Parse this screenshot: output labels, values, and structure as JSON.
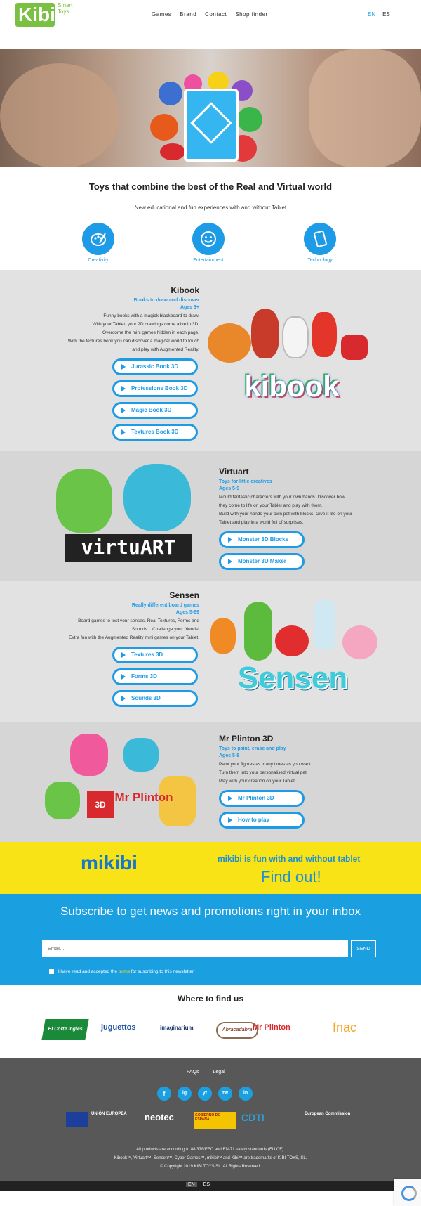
{
  "header": {
    "logo_text": "Kibi",
    "logo_sub": "Smart Toys",
    "nav": [
      "Games",
      "Brand",
      "Contact",
      "Shop finder"
    ],
    "lang": [
      "EN",
      "ES"
    ]
  },
  "intro": {
    "title": "Toys that combine the best of the Real and Virtual world",
    "subtitle": "New educational and fun experiences with and without Tablet",
    "features": [
      {
        "label": "Creativity",
        "icon": "palette-icon"
      },
      {
        "label": "Entertainment",
        "icon": "smiley-icon"
      },
      {
        "label": "Technology",
        "icon": "tablet-icon"
      }
    ]
  },
  "kibook": {
    "title": "Kibook",
    "subtitle": "Books to draw and discover",
    "age": "Ages 3+",
    "desc": [
      "Funny books with a magick blackboard to draw.",
      "With your Tablet, your 2D drawings come alive in 3D.",
      "Overcome the mini games hidden in each page.",
      "With the textures book you can discover a magical world to touch",
      "and play with Augmented Reality."
    ],
    "buttons": [
      "Jurassic Book 3D",
      "Professions Book 3D",
      "Magic Book 3D",
      "Textures Book 3D"
    ],
    "art_word": "kibook"
  },
  "virtuart": {
    "title": "Virtuart",
    "subtitle": "Toys for little creatives",
    "age": "Ages 5-9",
    "desc": [
      "Mould fantastic characters with your own hands. Discover how",
      "they come to life on your Tablet and play with them.",
      "Build with your hands your own pet with blocks. Give it life on your",
      "Tablet and play in a world full of surprises."
    ],
    "buttons": [
      "Monster 3D Blocks",
      "Monster 3D Maker"
    ],
    "art_word": "virtuART"
  },
  "sensen": {
    "title": "Sensen",
    "subtitle": "Really different board games",
    "age": "Ages 5-99",
    "desc": [
      "Board games to test your senses. Real Textures, Forms and",
      "Sounds... Challenge your friends!",
      "Extra fun with the Augmented Reality mini games on your Tablet."
    ],
    "buttons": [
      "Textures 3D",
      "Forms 3D",
      "Sounds 3D"
    ],
    "art_word": "Sensen"
  },
  "plinton": {
    "title": "Mr Plinton 3D",
    "subtitle": "Toys to paint, erase and play",
    "age": "Ages 5-8",
    "desc": [
      "Paint your figures as many times as you want.",
      "Turn them into your personalised virtual pet.",
      "Play with your creation on your Tablet."
    ],
    "buttons": [
      "Mr Plinton 3D",
      "How to play"
    ],
    "art_badge": "3D",
    "art_word": "Mr Plinton"
  },
  "mikibi": {
    "logo": "mikibi",
    "tagline": "mikibi is fun with and without tablet",
    "cta": "Find out!"
  },
  "subscribe": {
    "title": "Subscribe to get news and promotions right in your inbox",
    "email_placeholder": "Email...",
    "send": "SEND",
    "consent_pre": "I have read and accepted the",
    "consent_link": "terms",
    "consent_post": "for suscribing to this newsletter"
  },
  "where": {
    "title": "Where to find us",
    "shops": [
      "El Corte Inglés",
      "juguettos",
      "imaginarium",
      "Abracadabra",
      "Mr Plinton",
      "fnac"
    ]
  },
  "footer": {
    "links": [
      "FAQs",
      "Legal"
    ],
    "socials": [
      "f",
      "ig",
      "yt",
      "tw",
      "in"
    ],
    "sponsors": [
      "UNIÓN EUROPEA",
      "neotec",
      "GOBIERNO DE ESPAÑA",
      "CDTI",
      "European Commission"
    ],
    "notes": [
      "All products are according to 88/378/EEC and EN-71 safety standards (EU CE).",
      "Kibook™, Virtuart™, Sensen™, Cyber Games™, mikibi™ and Kibi™ are trademarks of KIBI TOYS, SL.",
      "© Copyright 2019 KIBI TOYS SL. All Rights Reserved."
    ]
  },
  "bottom_lang": [
    "EN",
    "ES"
  ],
  "colors": {
    "accent": "#1e9be6",
    "brand_green": "#7ac143",
    "mikibi_yellow": "#f7e316"
  }
}
